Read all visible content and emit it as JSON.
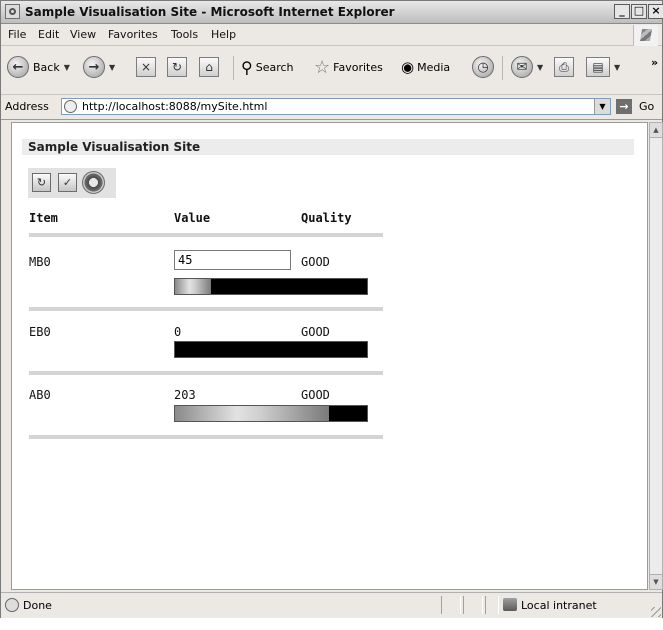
{
  "window": {
    "title": "Sample Visualisation Site - Microsoft Internet Explorer",
    "controls": {
      "minimize": "_",
      "maximize": "□",
      "close": "×"
    }
  },
  "menu": [
    "File",
    "Edit",
    "View",
    "Favorites",
    "Tools",
    "Help"
  ],
  "toolbar": {
    "back": "Back",
    "search": "Search",
    "favorites": "Favorites",
    "media": "Media",
    "more": "»"
  },
  "address": {
    "label": "Address",
    "url": "http://localhost:8088/mySite.html",
    "go": "Go"
  },
  "page": {
    "heading": "Sample Visualisation Site",
    "columns": {
      "item": "Item",
      "value": "Value",
      "quality": "Quality"
    },
    "rows": [
      {
        "item": "MB0",
        "value": "45",
        "quality": "GOOD",
        "level": 0.19,
        "editable": true
      },
      {
        "item": "EB0",
        "value": "0",
        "quality": "GOOD",
        "level": 0.0,
        "editable": false
      },
      {
        "item": "AB0",
        "value": "203",
        "quality": "GOOD",
        "level": 0.8,
        "editable": false
      }
    ]
  },
  "status": {
    "text": "Done",
    "zone": "Local intranet"
  }
}
